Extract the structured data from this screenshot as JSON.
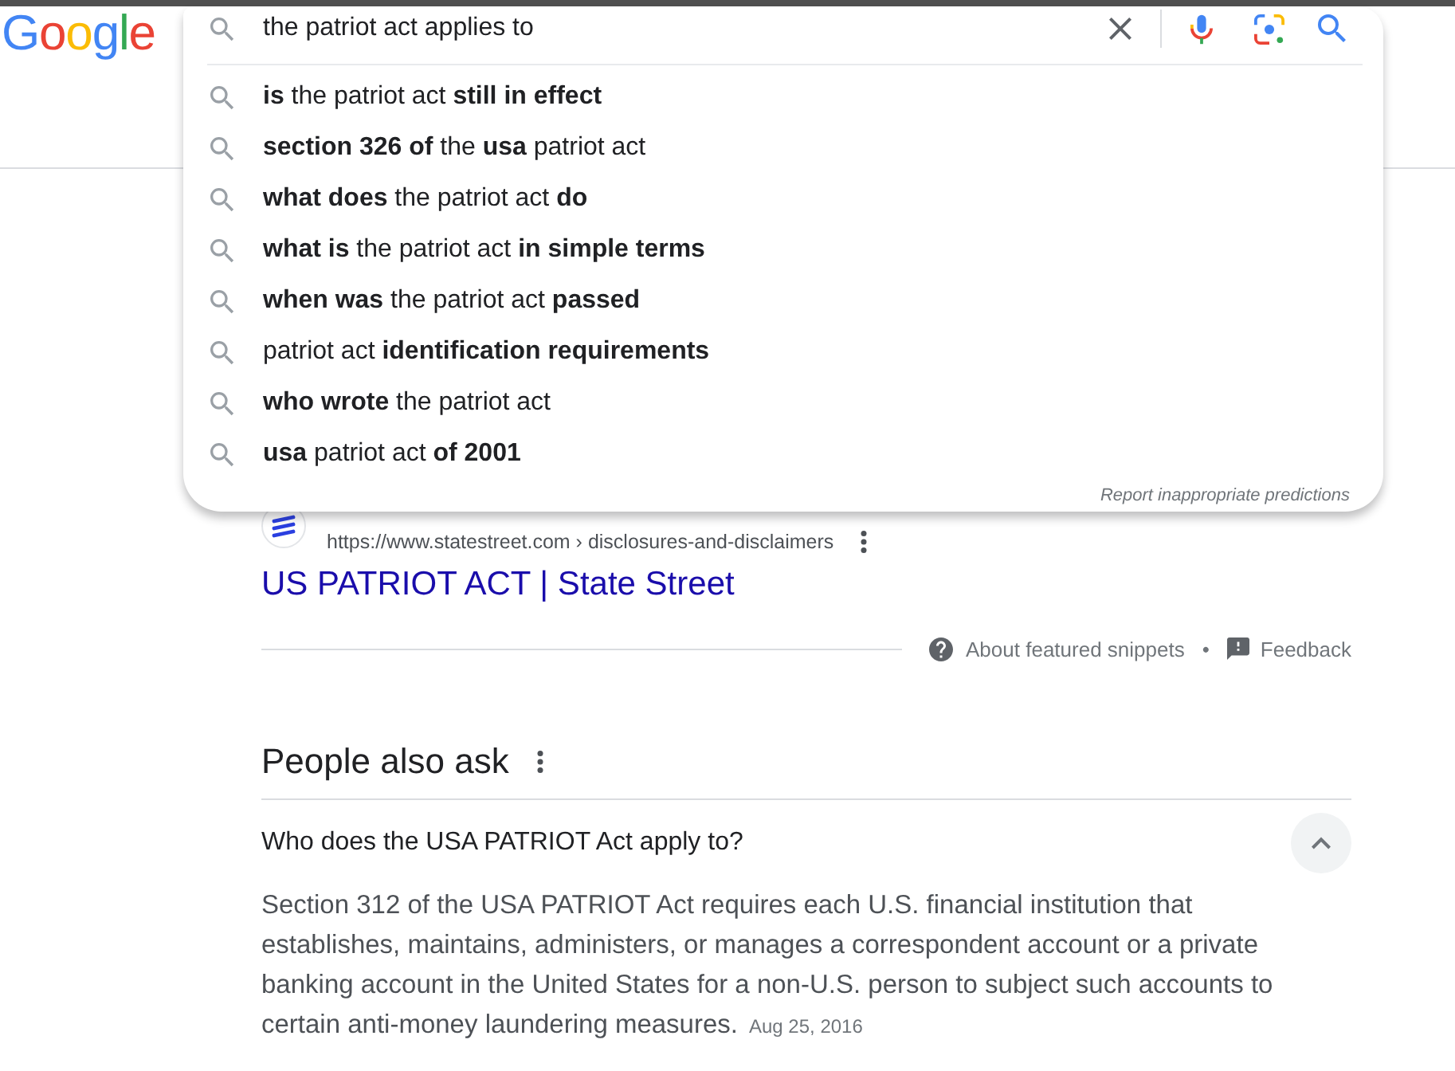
{
  "header": {
    "logo": "Google"
  },
  "search": {
    "query": "the patriot act applies to",
    "suggestions": [
      "**is** the patriot act **still in effect**",
      "**section 326 of** the **usa** patriot act",
      "**what does** the patriot act **do**",
      "**what is** the patriot act **in simple terms**",
      "**when was** the patriot act **passed**",
      "patriot act **identification requirements**",
      "**who wrote** the patriot act",
      "**usa** patriot act **of 2001**"
    ],
    "report_link": "Report inappropriate predictions"
  },
  "result": {
    "url": "https://www.statestreet.com › disclosures-and-disclaimers",
    "title": "US PATRIOT ACT | State Street"
  },
  "snippet_footer": {
    "about": "About featured snippets",
    "separator": "•",
    "feedback": "Feedback"
  },
  "people_also_ask": {
    "heading": "People also ask",
    "questions": [
      {
        "question": "Who does the USA PATRIOT Act apply to?",
        "expanded": true,
        "answer": "Section 312 of the USA PATRIOT Act requires each U.S. financial institution that establishes, maintains, administers, or manages a correspondent account or a private banking account in the United States for a non-U.S. person to subject such accounts to certain anti-money laundering measures.",
        "date": "Aug 25, 2016"
      }
    ]
  }
}
